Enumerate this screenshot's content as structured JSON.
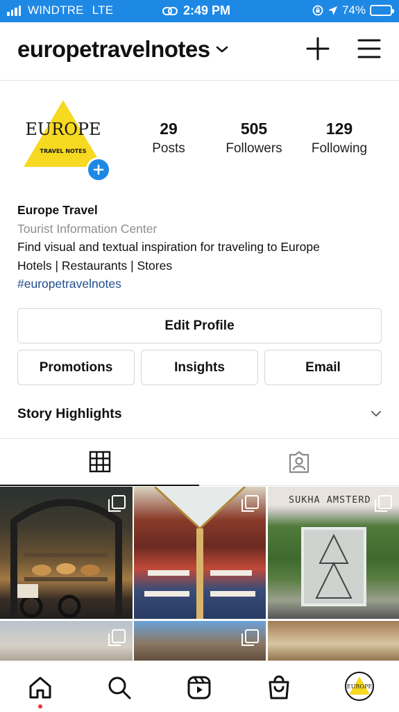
{
  "status_bar": {
    "carrier": "WINDTRE",
    "network": "LTE",
    "time": "2:49 PM",
    "battery": "74%",
    "battery_level": 0.74,
    "icons": [
      "signal-icon",
      "link-icon",
      "screen-lock-icon",
      "location-arrow-icon",
      "battery-icon"
    ]
  },
  "header": {
    "username": "europetravelnotes",
    "icons": [
      "chevron-down-icon",
      "plus-icon",
      "menu-icon"
    ]
  },
  "profile": {
    "avatar_logo_title": "EUROPE",
    "avatar_logo_subtitle": "TRAVEL NOTES",
    "stats": {
      "posts": {
        "value": "29",
        "label": "Posts"
      },
      "followers": {
        "value": "505",
        "label": "Followers"
      },
      "following": {
        "value": "129",
        "label": "Following"
      }
    },
    "bio": {
      "name": "Europe Travel",
      "category": "Tourist Information Center",
      "line1": "Find visual and textual inspiration for traveling to Europe",
      "line2": "Hotels | Restaurants | Stores",
      "hashtag": "#europetravelnotes"
    }
  },
  "buttons": {
    "edit_profile": "Edit Profile",
    "promotions": "Promotions",
    "insights": "Insights",
    "email": "Email"
  },
  "highlights": {
    "title": "Story Highlights"
  },
  "tabs": [
    "grid-icon",
    "tagged-icon"
  ],
  "posts": {
    "sign_text": "SUKHA AMSTERD",
    "items": [
      "bakery-window",
      "restaurant-interior",
      "green-storefront",
      "building-facade",
      "ornate-building",
      "church-interior"
    ]
  },
  "bottom_nav": [
    "home-icon",
    "search-icon",
    "reels-icon",
    "shop-icon",
    "profile-avatar"
  ],
  "colors": {
    "status_bar": "#1e88e5",
    "accent_blue": "#1e88e5",
    "logo_yellow": "#f6d920",
    "hashtag": "#1f4e8c",
    "notification_dot": "#e53935"
  }
}
